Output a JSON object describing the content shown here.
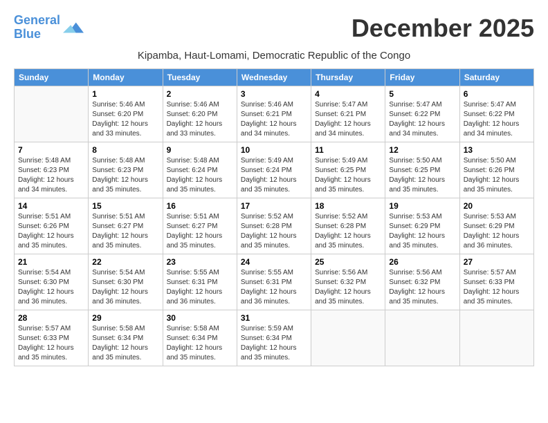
{
  "logo": {
    "line1": "General",
    "line2": "Blue"
  },
  "header": {
    "month": "December 2025",
    "location": "Kipamba, Haut-Lomami, Democratic Republic of the Congo"
  },
  "weekdays": [
    "Sunday",
    "Monday",
    "Tuesday",
    "Wednesday",
    "Thursday",
    "Friday",
    "Saturday"
  ],
  "weeks": [
    [
      {
        "day": "",
        "info": ""
      },
      {
        "day": "1",
        "info": "Sunrise: 5:46 AM\nSunset: 6:20 PM\nDaylight: 12 hours\nand 33 minutes."
      },
      {
        "day": "2",
        "info": "Sunrise: 5:46 AM\nSunset: 6:20 PM\nDaylight: 12 hours\nand 33 minutes."
      },
      {
        "day": "3",
        "info": "Sunrise: 5:46 AM\nSunset: 6:21 PM\nDaylight: 12 hours\nand 34 minutes."
      },
      {
        "day": "4",
        "info": "Sunrise: 5:47 AM\nSunset: 6:21 PM\nDaylight: 12 hours\nand 34 minutes."
      },
      {
        "day": "5",
        "info": "Sunrise: 5:47 AM\nSunset: 6:22 PM\nDaylight: 12 hours\nand 34 minutes."
      },
      {
        "day": "6",
        "info": "Sunrise: 5:47 AM\nSunset: 6:22 PM\nDaylight: 12 hours\nand 34 minutes."
      }
    ],
    [
      {
        "day": "7",
        "info": "Sunrise: 5:48 AM\nSunset: 6:23 PM\nDaylight: 12 hours\nand 34 minutes."
      },
      {
        "day": "8",
        "info": "Sunrise: 5:48 AM\nSunset: 6:23 PM\nDaylight: 12 hours\nand 35 minutes."
      },
      {
        "day": "9",
        "info": "Sunrise: 5:48 AM\nSunset: 6:24 PM\nDaylight: 12 hours\nand 35 minutes."
      },
      {
        "day": "10",
        "info": "Sunrise: 5:49 AM\nSunset: 6:24 PM\nDaylight: 12 hours\nand 35 minutes."
      },
      {
        "day": "11",
        "info": "Sunrise: 5:49 AM\nSunset: 6:25 PM\nDaylight: 12 hours\nand 35 minutes."
      },
      {
        "day": "12",
        "info": "Sunrise: 5:50 AM\nSunset: 6:25 PM\nDaylight: 12 hours\nand 35 minutes."
      },
      {
        "day": "13",
        "info": "Sunrise: 5:50 AM\nSunset: 6:26 PM\nDaylight: 12 hours\nand 35 minutes."
      }
    ],
    [
      {
        "day": "14",
        "info": "Sunrise: 5:51 AM\nSunset: 6:26 PM\nDaylight: 12 hours\nand 35 minutes."
      },
      {
        "day": "15",
        "info": "Sunrise: 5:51 AM\nSunset: 6:27 PM\nDaylight: 12 hours\nand 35 minutes."
      },
      {
        "day": "16",
        "info": "Sunrise: 5:51 AM\nSunset: 6:27 PM\nDaylight: 12 hours\nand 35 minutes."
      },
      {
        "day": "17",
        "info": "Sunrise: 5:52 AM\nSunset: 6:28 PM\nDaylight: 12 hours\nand 35 minutes."
      },
      {
        "day": "18",
        "info": "Sunrise: 5:52 AM\nSunset: 6:28 PM\nDaylight: 12 hours\nand 35 minutes."
      },
      {
        "day": "19",
        "info": "Sunrise: 5:53 AM\nSunset: 6:29 PM\nDaylight: 12 hours\nand 35 minutes."
      },
      {
        "day": "20",
        "info": "Sunrise: 5:53 AM\nSunset: 6:29 PM\nDaylight: 12 hours\nand 36 minutes."
      }
    ],
    [
      {
        "day": "21",
        "info": "Sunrise: 5:54 AM\nSunset: 6:30 PM\nDaylight: 12 hours\nand 36 minutes."
      },
      {
        "day": "22",
        "info": "Sunrise: 5:54 AM\nSunset: 6:30 PM\nDaylight: 12 hours\nand 36 minutes."
      },
      {
        "day": "23",
        "info": "Sunrise: 5:55 AM\nSunset: 6:31 PM\nDaylight: 12 hours\nand 36 minutes."
      },
      {
        "day": "24",
        "info": "Sunrise: 5:55 AM\nSunset: 6:31 PM\nDaylight: 12 hours\nand 36 minutes."
      },
      {
        "day": "25",
        "info": "Sunrise: 5:56 AM\nSunset: 6:32 PM\nDaylight: 12 hours\nand 35 minutes."
      },
      {
        "day": "26",
        "info": "Sunrise: 5:56 AM\nSunset: 6:32 PM\nDaylight: 12 hours\nand 35 minutes."
      },
      {
        "day": "27",
        "info": "Sunrise: 5:57 AM\nSunset: 6:33 PM\nDaylight: 12 hours\nand 35 minutes."
      }
    ],
    [
      {
        "day": "28",
        "info": "Sunrise: 5:57 AM\nSunset: 6:33 PM\nDaylight: 12 hours\nand 35 minutes."
      },
      {
        "day": "29",
        "info": "Sunrise: 5:58 AM\nSunset: 6:34 PM\nDaylight: 12 hours\nand 35 minutes."
      },
      {
        "day": "30",
        "info": "Sunrise: 5:58 AM\nSunset: 6:34 PM\nDaylight: 12 hours\nand 35 minutes."
      },
      {
        "day": "31",
        "info": "Sunrise: 5:59 AM\nSunset: 6:34 PM\nDaylight: 12 hours\nand 35 minutes."
      },
      {
        "day": "",
        "info": ""
      },
      {
        "day": "",
        "info": ""
      },
      {
        "day": "",
        "info": ""
      }
    ]
  ]
}
